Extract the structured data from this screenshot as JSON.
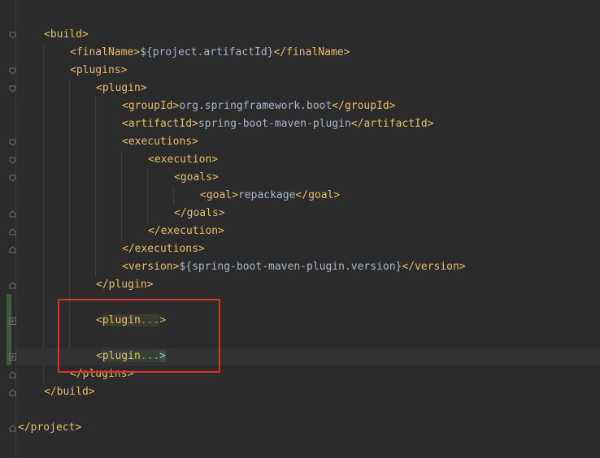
{
  "editor": {
    "lines": [
      {
        "open": "<",
        "tag": "build",
        "close": ">"
      },
      {
        "open": "<",
        "tag": "finalName",
        "close": ">",
        "text": "${project.artifactId}",
        "end_open": "</",
        "end_tag": "finalName",
        "end_close": ">"
      },
      {
        "open": "<",
        "tag": "plugins",
        "close": ">"
      },
      {
        "open": "<",
        "tag": "plugin",
        "close": ">"
      },
      {
        "open": "<",
        "tag": "groupId",
        "close": ">",
        "text": "org.springframework.boot",
        "end_open": "</",
        "end_tag": "groupId",
        "end_close": ">"
      },
      {
        "open": "<",
        "tag": "artifactId",
        "close": ">",
        "text": "spring-boot-maven-plugin",
        "end_open": "</",
        "end_tag": "artifactId",
        "end_close": ">"
      },
      {
        "open": "<",
        "tag": "executions",
        "close": ">"
      },
      {
        "open": "<",
        "tag": "execution",
        "close": ">"
      },
      {
        "open": "<",
        "tag": "goals",
        "close": ">"
      },
      {
        "open": "<",
        "tag": "goal",
        "close": ">",
        "text": "repackage",
        "end_open": "</",
        "end_tag": "goal",
        "end_close": ">"
      },
      {
        "open": "</",
        "tag": "goals",
        "close": ">"
      },
      {
        "open": "</",
        "tag": "execution",
        "close": ">"
      },
      {
        "open": "</",
        "tag": "executions",
        "close": ">"
      },
      {
        "open": "<",
        "tag": "version",
        "close": ">",
        "text": "${spring-boot-maven-plugin.version}",
        "end_open": "</",
        "end_tag": "version",
        "end_close": ">"
      },
      {
        "open": "</",
        "tag": "plugin",
        "close": ">"
      },
      {
        "open": "<",
        "tag": "plugin",
        "dots": "...",
        "close": ">"
      },
      {
        "open": "<",
        "tag": "plugin",
        "dots": "...",
        "close": ">"
      },
      {
        "open": "</",
        "tag": "plugins",
        "close": ">"
      },
      {
        "open": "</",
        "tag": "build",
        "close": ">"
      },
      {
        "open": "</",
        "tag": "project",
        "close": ">"
      }
    ]
  },
  "colors": {
    "background": "#2b2b2b",
    "tag": "#e8bf6a",
    "text": "#a9b7c6",
    "highlight_box": "#e0322d"
  }
}
